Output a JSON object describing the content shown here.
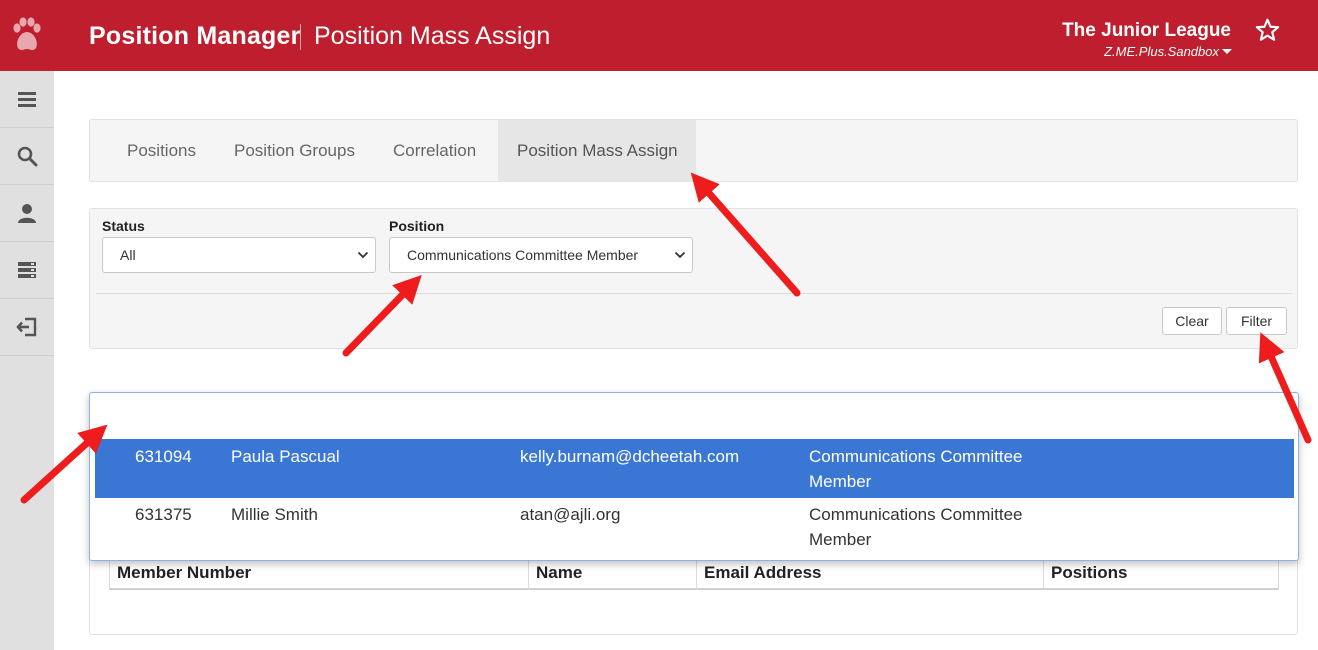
{
  "header": {
    "app_title": "Position Manager",
    "page_title": "Position Mass Assign",
    "org_name": "The Junior League",
    "org_env": "Z.ME.Plus.Sandbox",
    "brand_color": "#be1e2d"
  },
  "sidebar": {
    "items": [
      {
        "icon": "menu-icon"
      },
      {
        "icon": "search-icon"
      },
      {
        "icon": "user-icon"
      },
      {
        "icon": "server-icon"
      },
      {
        "icon": "logout-icon"
      }
    ]
  },
  "tabs": [
    {
      "label": "Positions",
      "active": false
    },
    {
      "label": "Position Groups",
      "active": false
    },
    {
      "label": "Correlation",
      "active": false
    },
    {
      "label": "Position Mass Assign",
      "active": true
    }
  ],
  "filters": {
    "status_label": "Status",
    "status_value": "All",
    "position_label": "Position",
    "position_value": "Communications Committee Member",
    "clear_label": "Clear",
    "filter_label": "Filter"
  },
  "autocomplete": {
    "highlight_color": "#3a77d4",
    "rows": [
      {
        "number": "631094",
        "name": "Paula Pascual",
        "email": "kelly.burnam@dcheetah.com",
        "position_line1": "Communications Committee",
        "position_line2": "Member",
        "selected": true
      },
      {
        "number": "631375",
        "name": "Millie Smith",
        "email": "atan@ajli.org",
        "position_line1": "Communications Committee",
        "position_line2": "Member",
        "selected": false
      }
    ]
  },
  "table": {
    "headers": [
      "Member Number",
      "Name",
      "Email Address",
      "Positions"
    ]
  },
  "annotations": {
    "arrow_color": "#ee1c1c"
  }
}
